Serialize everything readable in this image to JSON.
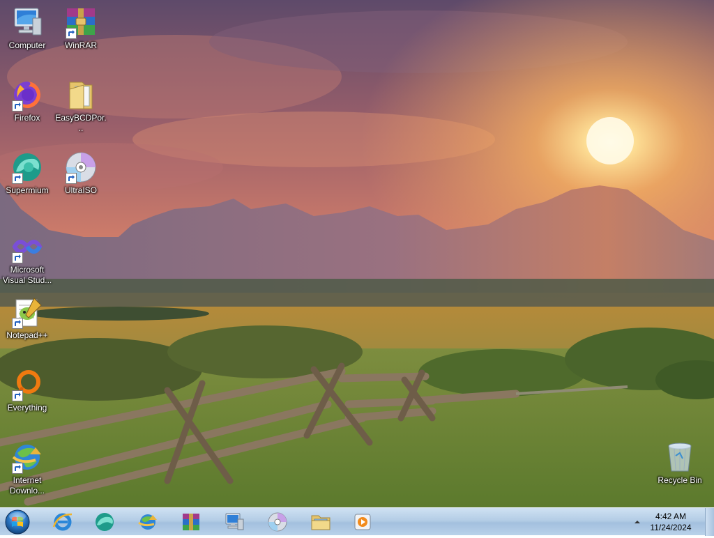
{
  "desktop": {
    "icons": [
      {
        "id": "computer",
        "label": "Computer",
        "icon": "computer-icon"
      },
      {
        "id": "winrar",
        "label": "WinRAR",
        "icon": "winrar-icon"
      },
      {
        "id": "firefox",
        "label": "Firefox",
        "icon": "firefox-icon"
      },
      {
        "id": "easybcd",
        "label": "EasyBCDPor...",
        "icon": "folder-icon"
      },
      {
        "id": "supermium",
        "label": "Supermium",
        "icon": "supermium-icon"
      },
      {
        "id": "ultraiso",
        "label": "UltraISO",
        "icon": "disc-icon"
      },
      {
        "id": "vs",
        "label": "Microsoft Visual Stud...",
        "icon": "visual-studio-icon"
      },
      {
        "id": "notepadpp",
        "label": "Notepad++",
        "icon": "notepadpp-icon"
      },
      {
        "id": "everything",
        "label": "Everything",
        "icon": "everything-icon"
      },
      {
        "id": "idm",
        "label": "Internet Downlo...",
        "icon": "internet-download-manager-icon"
      },
      {
        "id": "recyclebin",
        "label": "Recycle Bin",
        "icon": "recycle-bin-icon"
      }
    ]
  },
  "taskbar": {
    "pinned": [
      {
        "id": "ie",
        "icon": "internet-explorer-icon"
      },
      {
        "id": "supermium",
        "icon": "supermium-icon"
      },
      {
        "id": "idm",
        "icon": "internet-download-manager-icon"
      },
      {
        "id": "winrar",
        "icon": "winrar-icon"
      },
      {
        "id": "computer",
        "icon": "computer-icon"
      },
      {
        "id": "disc",
        "icon": "disc-icon"
      },
      {
        "id": "explorer",
        "icon": "folder-icon"
      },
      {
        "id": "media",
        "icon": "media-player-icon"
      }
    ],
    "clock": {
      "time": "4:42 AM",
      "date": "11/24/2024"
    }
  },
  "colors": {
    "taskbar": "#b4cde6",
    "sky_top": "#6a4d6e",
    "sky_sun": "#f4a85a"
  }
}
